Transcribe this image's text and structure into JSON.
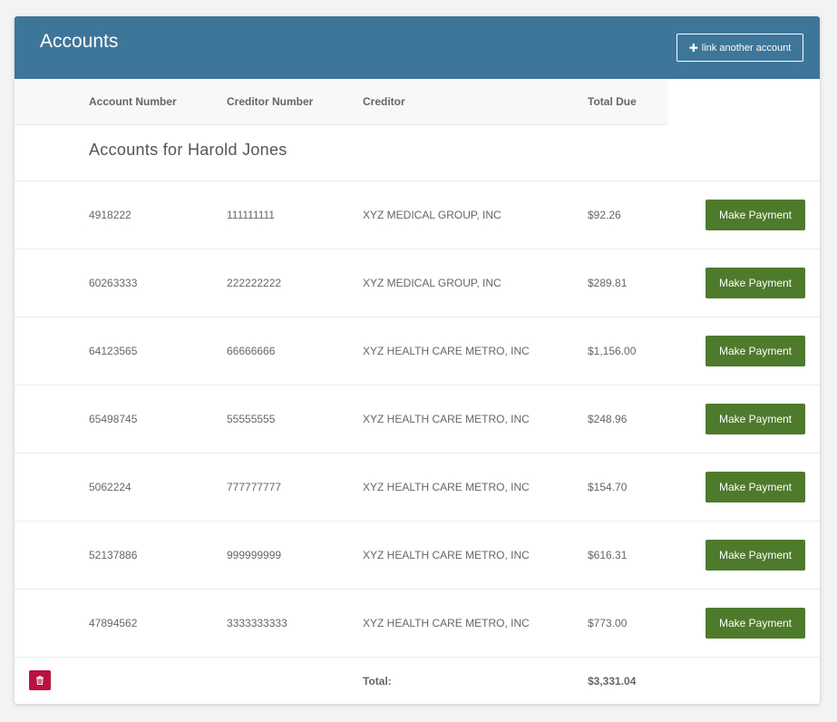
{
  "header": {
    "title": "Accounts",
    "link_button_label": "link another account"
  },
  "table": {
    "columns": [
      "Account Number",
      "Creditor Number",
      "Creditor",
      "Total Due"
    ],
    "group_title": "Accounts for Harold Jones",
    "rows": [
      {
        "account_number": "4918222",
        "creditor_number": "111111111",
        "creditor": "XYZ MEDICAL GROUP, INC",
        "total_due": "$92.26",
        "action": "Make Payment"
      },
      {
        "account_number": "60263333",
        "creditor_number": "222222222",
        "creditor": "XYZ MEDICAL GROUP, INC",
        "total_due": "$289.81",
        "action": "Make Payment"
      },
      {
        "account_number": "64123565",
        "creditor_number": "66666666",
        "creditor": "XYZ HEALTH CARE METRO, INC",
        "total_due": "$1,156.00",
        "action": "Make Payment"
      },
      {
        "account_number": "65498745",
        "creditor_number": "55555555",
        "creditor": "XYZ HEALTH CARE METRO, INC",
        "total_due": "$248.96",
        "action": "Make Payment"
      },
      {
        "account_number": "5062224",
        "creditor_number": "777777777",
        "creditor": "XYZ HEALTH CARE METRO, INC",
        "total_due": "$154.70",
        "action": "Make Payment"
      },
      {
        "account_number": "52137886",
        "creditor_number": "999999999",
        "creditor": "XYZ HEALTH CARE METRO, INC",
        "total_due": "$616.31",
        "action": "Make Payment"
      },
      {
        "account_number": "47894562",
        "creditor_number": "3333333333",
        "creditor": "XYZ HEALTH CARE METRO, INC",
        "total_due": "$773.00",
        "action": "Make Payment"
      }
    ],
    "total_label": "Total:",
    "total_value": "$3,331.04"
  },
  "icons": {
    "link_button": "plus-icon",
    "delete_button": "trash-icon"
  },
  "colors": {
    "header_bg": "#3e7699",
    "pay_button": "#4e7a2b",
    "delete_button": "#b8123e"
  }
}
